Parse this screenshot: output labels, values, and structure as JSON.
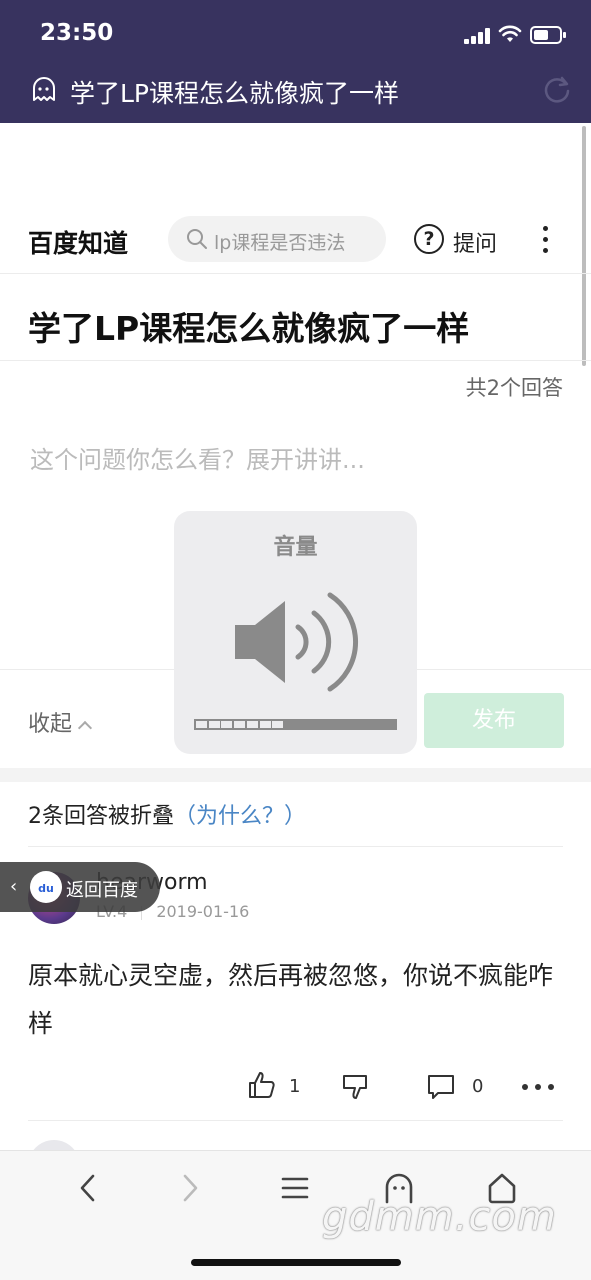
{
  "status": {
    "time": "23:50"
  },
  "browser": {
    "page_title": "学了LP课程怎么就像疯了一样"
  },
  "nav": {
    "logo": "百度知道",
    "search_placeholder": "lp课程是否违法",
    "ask_label": "提问"
  },
  "question": {
    "title": "学了LP课程怎么就像疯了一样",
    "answer_count": "共2个回答"
  },
  "editor": {
    "placeholder": "这个问题你怎么看？展开讲讲...",
    "collapse_label": "收起",
    "publish_label": "发布"
  },
  "volume_hud": {
    "title": "音量",
    "level": 0.44
  },
  "folded": {
    "text": "2条回答被折叠",
    "why": "（为什么？）"
  },
  "back_pill": {
    "label": "返回百度",
    "logo_text": "du"
  },
  "answer": {
    "user": "hearworm",
    "level": "LV.4",
    "date": "2019-01-16",
    "content": "原本就心灵空虚，然后再被忽悠，你说不疯能咋样",
    "likes": "1",
    "comments": "0"
  },
  "watermark": "gdmm.com",
  "colors": {
    "header_bg": "#38335f",
    "publish_bg": "#cfeedb",
    "link_blue": "#4a86c5"
  }
}
